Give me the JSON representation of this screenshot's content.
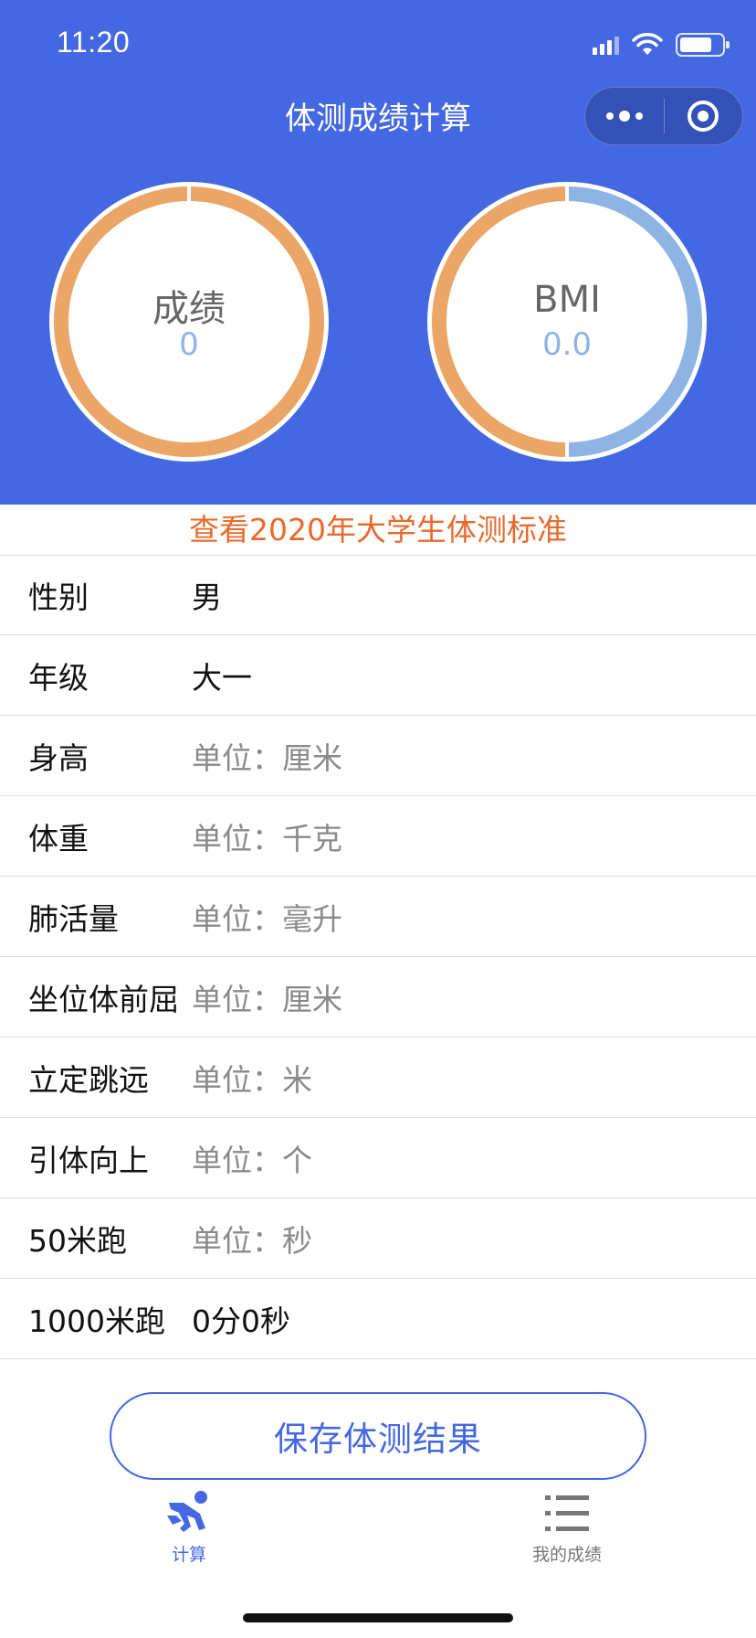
{
  "status_bar": {
    "time": "11:20"
  },
  "nav": {
    "title": "体测成绩计算"
  },
  "gauges": {
    "score": {
      "label": "成绩",
      "value": "0",
      "color_left": "#EBA566",
      "color_right": "#EBA566"
    },
    "bmi": {
      "label": "BMI",
      "value": "0.0",
      "color_left": "#EBA566",
      "color_right": "#8EB4E3"
    }
  },
  "standard_link": "查看2020年大学生体测标准",
  "form": {
    "rows": [
      {
        "label": "性别",
        "value": "男",
        "placeholder": false
      },
      {
        "label": "年级",
        "value": "大一",
        "placeholder": false
      },
      {
        "label": "身高",
        "value": "单位：厘米",
        "placeholder": true
      },
      {
        "label": "体重",
        "value": "单位：千克",
        "placeholder": true
      },
      {
        "label": "肺活量",
        "value": "单位：毫升",
        "placeholder": true
      },
      {
        "label": "坐位体前屈",
        "value": "单位：厘米",
        "placeholder": true
      },
      {
        "label": "立定跳远",
        "value": "单位：米",
        "placeholder": true
      },
      {
        "label": "引体向上",
        "value": "单位：个",
        "placeholder": true
      },
      {
        "label": "50米跑",
        "value": "单位：秒",
        "placeholder": true
      },
      {
        "label": "1000米跑",
        "value": "0分0秒",
        "placeholder": false
      }
    ]
  },
  "save_button": "保存体测结果",
  "tabbar": {
    "items": [
      {
        "label": "计算",
        "icon": "running-person-icon",
        "active": true
      },
      {
        "label": "我的成绩",
        "icon": "list-icon",
        "active": false
      }
    ]
  },
  "colors": {
    "primary": "#4468E2",
    "accent_orange": "#E86A2C",
    "gauge_orange": "#EBA566",
    "gauge_blue": "#8EB4E3"
  }
}
